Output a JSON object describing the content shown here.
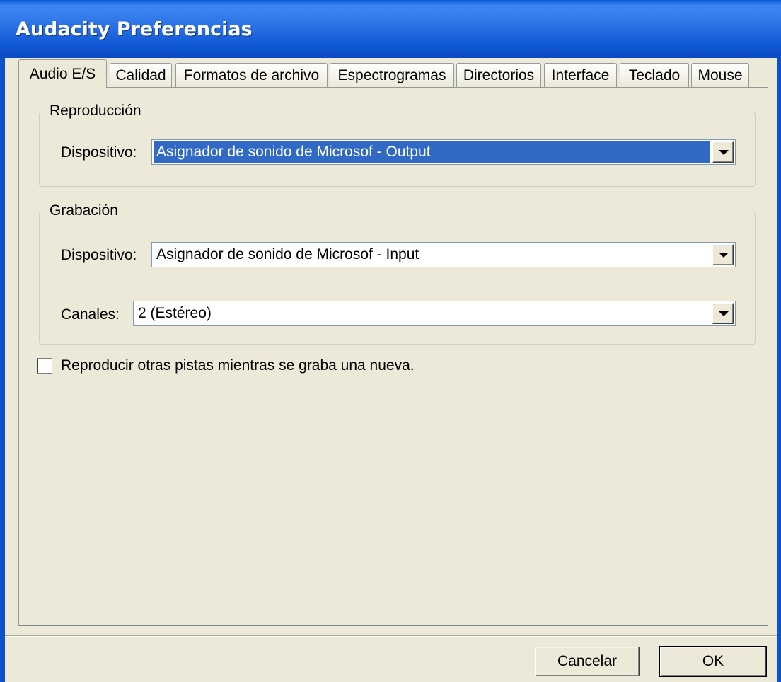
{
  "window": {
    "title": "Audacity Preferencias"
  },
  "tabs": [
    {
      "label": "Audio E/S",
      "active": true
    },
    {
      "label": "Calidad"
    },
    {
      "label": "Formatos de archivo"
    },
    {
      "label": "Espectrogramas"
    },
    {
      "label": "Directorios"
    },
    {
      "label": "Interface"
    },
    {
      "label": "Teclado"
    },
    {
      "label": "Mouse"
    }
  ],
  "playback": {
    "group_label": "Reproducción",
    "device_label": "Dispositivo:",
    "device_value": "Asignador de sonido de Microsof - Output"
  },
  "recording": {
    "group_label": "Grabación",
    "device_label": "Dispositivo:",
    "device_value": "Asignador de sonido de Microsof - Input",
    "channels_label": "Canales:",
    "channels_value": "2 (Estéreo)"
  },
  "options": {
    "play_other_tracks_label": "Reproducir otras pistas mientras se graba una nueva.",
    "play_other_tracks_checked": false
  },
  "buttons": {
    "cancel": "Cancelar",
    "ok": "OK"
  },
  "colors": {
    "titlebar": "#0a5ad8",
    "selection": "#316ac5",
    "face": "#ece9d8"
  }
}
